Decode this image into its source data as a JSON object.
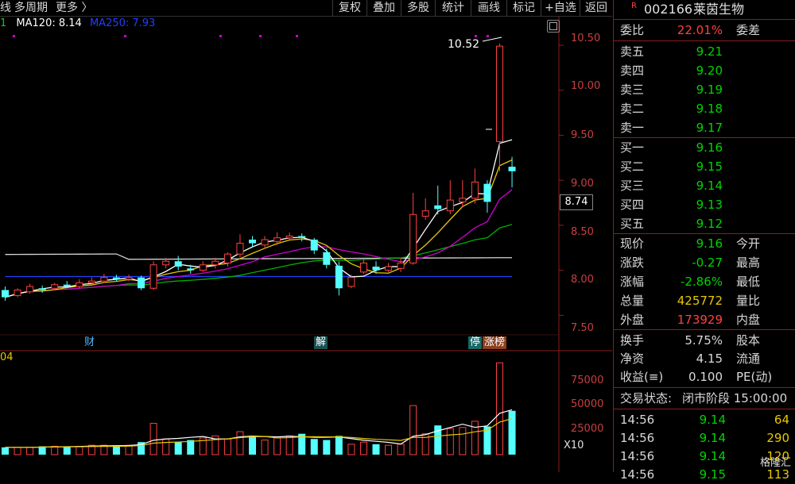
{
  "toolbar": {
    "left_items": [
      "线",
      "多周期",
      "更多 〉"
    ],
    "buttons": [
      "复权",
      "叠加",
      "多股",
      "统计",
      "画线",
      "标记",
      "+自选",
      "返回"
    ]
  },
  "ma_legend": {
    "prefix": "1",
    "ma120": "MA120: 8.14",
    "ma250": "MA250: 7.93"
  },
  "price_axis": {
    "ticks": [
      "10.50",
      "10.00",
      "9.50",
      "9.00",
      "8.50",
      "8.00",
      "7.50"
    ],
    "current_tag": "8.74",
    "high_annotation": "10.52"
  },
  "volume_axis": {
    "ticks": [
      "75000",
      "50000",
      "25000"
    ],
    "unit": "X10",
    "legend_fragment": "04"
  },
  "events": [
    {
      "label": "财",
      "color": "#4fb8ff"
    },
    {
      "label": "解",
      "color": "#ffffff"
    },
    {
      "label": "停",
      "color": "#ffffff"
    },
    {
      "label": "涨榜",
      "color": "#ffffff"
    }
  ],
  "stock": {
    "badge": "R",
    "code": "002166",
    "name": "莱茵生物"
  },
  "order_book": {
    "ratio_label": "委比",
    "ratio_value": "22.01%",
    "diff_label": "委差",
    "asks": [
      {
        "label": "卖五",
        "price": "9.21"
      },
      {
        "label": "卖四",
        "price": "9.20"
      },
      {
        "label": "卖三",
        "price": "9.19"
      },
      {
        "label": "卖二",
        "price": "9.18"
      },
      {
        "label": "卖一",
        "price": "9.17"
      }
    ],
    "bids": [
      {
        "label": "买一",
        "price": "9.16"
      },
      {
        "label": "买二",
        "price": "9.15"
      },
      {
        "label": "买三",
        "price": "9.14"
      },
      {
        "label": "买四",
        "price": "9.13"
      },
      {
        "label": "买五",
        "price": "9.12"
      }
    ]
  },
  "quote": [
    {
      "label": "现价",
      "value": "9.16",
      "color": "green",
      "label2": "今开"
    },
    {
      "label": "涨跌",
      "value": "-0.27",
      "color": "green",
      "label2": "最高"
    },
    {
      "label": "涨幅",
      "value": "-2.86%",
      "color": "green",
      "label2": "最低"
    },
    {
      "label": "总量",
      "value": "425772",
      "color": "yellow",
      "label2": "量比"
    },
    {
      "label": "外盘",
      "value": "173929",
      "color": "red",
      "label2": "内盘"
    }
  ],
  "fundamentals": [
    {
      "label": "换手",
      "value": "5.75%",
      "label2": "股本"
    },
    {
      "label": "净资",
      "value": "4.15",
      "label2": "流通"
    },
    {
      "label": "收益(≡)",
      "value": "0.100",
      "label2": "PE(动)"
    }
  ],
  "status": {
    "label": "交易状态:",
    "value": "闭市阶段 15:00:00"
  },
  "ticks": [
    {
      "time": "14:56",
      "price": "9.14",
      "vol": "64"
    },
    {
      "time": "14:56",
      "price": "9.14",
      "vol": "290"
    },
    {
      "time": "14:56",
      "price": "9.14",
      "vol": "120"
    },
    {
      "time": "14:56",
      "price": "9.15",
      "vol": "113"
    }
  ],
  "watermark": "格隆汇",
  "chart_data": {
    "type": "candlestick",
    "price_ylim": [
      7.3,
      10.65
    ],
    "candles": [
      {
        "o": 7.78,
        "c": 7.7,
        "h": 7.82,
        "l": 7.66
      },
      {
        "o": 7.72,
        "c": 7.78,
        "h": 7.8,
        "l": 7.7
      },
      {
        "o": 7.76,
        "c": 7.82,
        "h": 7.85,
        "l": 7.74
      },
      {
        "o": 7.8,
        "c": 7.78,
        "h": 7.83,
        "l": 7.75
      },
      {
        "o": 7.8,
        "c": 7.84,
        "h": 7.86,
        "l": 7.78
      },
      {
        "o": 7.84,
        "c": 7.82,
        "h": 7.88,
        "l": 7.8
      },
      {
        "o": 7.82,
        "c": 7.86,
        "h": 7.9,
        "l": 7.8
      },
      {
        "o": 7.86,
        "c": 7.88,
        "h": 7.92,
        "l": 7.84
      },
      {
        "o": 7.88,
        "c": 7.92,
        "h": 7.96,
        "l": 7.86
      },
      {
        "o": 7.92,
        "c": 7.9,
        "h": 7.95,
        "l": 7.88
      },
      {
        "o": 7.9,
        "c": 7.92,
        "h": 7.95,
        "l": 7.88
      },
      {
        "o": 7.92,
        "c": 7.8,
        "h": 7.94,
        "l": 7.78
      },
      {
        "o": 7.8,
        "c": 8.06,
        "h": 8.1,
        "l": 7.78
      },
      {
        "o": 8.06,
        "c": 8.1,
        "h": 8.14,
        "l": 8.02
      },
      {
        "o": 8.1,
        "c": 8.04,
        "h": 8.16,
        "l": 8.0
      },
      {
        "o": 8.02,
        "c": 8.0,
        "h": 8.06,
        "l": 7.96
      },
      {
        "o": 8.0,
        "c": 8.06,
        "h": 8.1,
        "l": 7.98
      },
      {
        "o": 8.06,
        "c": 8.1,
        "h": 8.14,
        "l": 8.02
      },
      {
        "o": 8.08,
        "c": 8.18,
        "h": 8.2,
        "l": 8.04
      },
      {
        "o": 8.18,
        "c": 8.3,
        "h": 8.4,
        "l": 8.14
      },
      {
        "o": 8.34,
        "c": 8.3,
        "h": 8.38,
        "l": 8.26
      },
      {
        "o": 8.28,
        "c": 8.34,
        "h": 8.38,
        "l": 8.24
      },
      {
        "o": 8.32,
        "c": 8.36,
        "h": 8.42,
        "l": 8.28
      },
      {
        "o": 8.36,
        "c": 8.38,
        "h": 8.42,
        "l": 8.34
      },
      {
        "o": 8.38,
        "c": 8.36,
        "h": 8.41,
        "l": 8.32
      },
      {
        "o": 8.34,
        "c": 8.22,
        "h": 8.36,
        "l": 8.18
      },
      {
        "o": 8.2,
        "c": 8.06,
        "h": 8.24,
        "l": 8.02
      },
      {
        "o": 8.05,
        "c": 7.8,
        "h": 8.1,
        "l": 7.72
      },
      {
        "o": 7.82,
        "c": 7.92,
        "h": 7.95,
        "l": 7.8
      },
      {
        "o": 7.98,
        "c": 8.08,
        "h": 8.12,
        "l": 7.96
      },
      {
        "o": 8.04,
        "c": 8.0,
        "h": 8.1,
        "l": 7.96
      },
      {
        "o": 8.0,
        "c": 8.04,
        "h": 8.08,
        "l": 7.98
      },
      {
        "o": 8.02,
        "c": 8.08,
        "h": 8.14,
        "l": 7.98
      },
      {
        "o": 8.08,
        "c": 8.62,
        "h": 8.86,
        "l": 8.06
      },
      {
        "o": 8.6,
        "c": 8.66,
        "h": 8.8,
        "l": 8.56
      },
      {
        "o": 8.72,
        "c": 8.68,
        "h": 8.94,
        "l": 8.62
      },
      {
        "o": 8.66,
        "c": 8.78,
        "h": 9.0,
        "l": 8.62
      },
      {
        "o": 8.76,
        "c": 8.8,
        "h": 9.0,
        "l": 8.7
      },
      {
        "o": 8.8,
        "c": 8.98,
        "h": 9.13,
        "l": 8.74
      },
      {
        "o": 8.96,
        "c": 8.76,
        "h": 9.0,
        "l": 8.64
      },
      {
        "o": 9.43,
        "c": 10.49,
        "h": 10.52,
        "l": 9.1
      },
      {
        "o": 9.15,
        "c": 9.1,
        "h": 9.26,
        "l": 8.92
      }
    ],
    "volumes": [
      7,
      7,
      7,
      8,
      8,
      8,
      8,
      9,
      9,
      9,
      9,
      12,
      30,
      15,
      12,
      14,
      16,
      18,
      15,
      22,
      18,
      14,
      16,
      18,
      20,
      15,
      14,
      18,
      10,
      12,
      10,
      9,
      10,
      47,
      20,
      28,
      25,
      26,
      32,
      27,
      88,
      42
    ]
  }
}
